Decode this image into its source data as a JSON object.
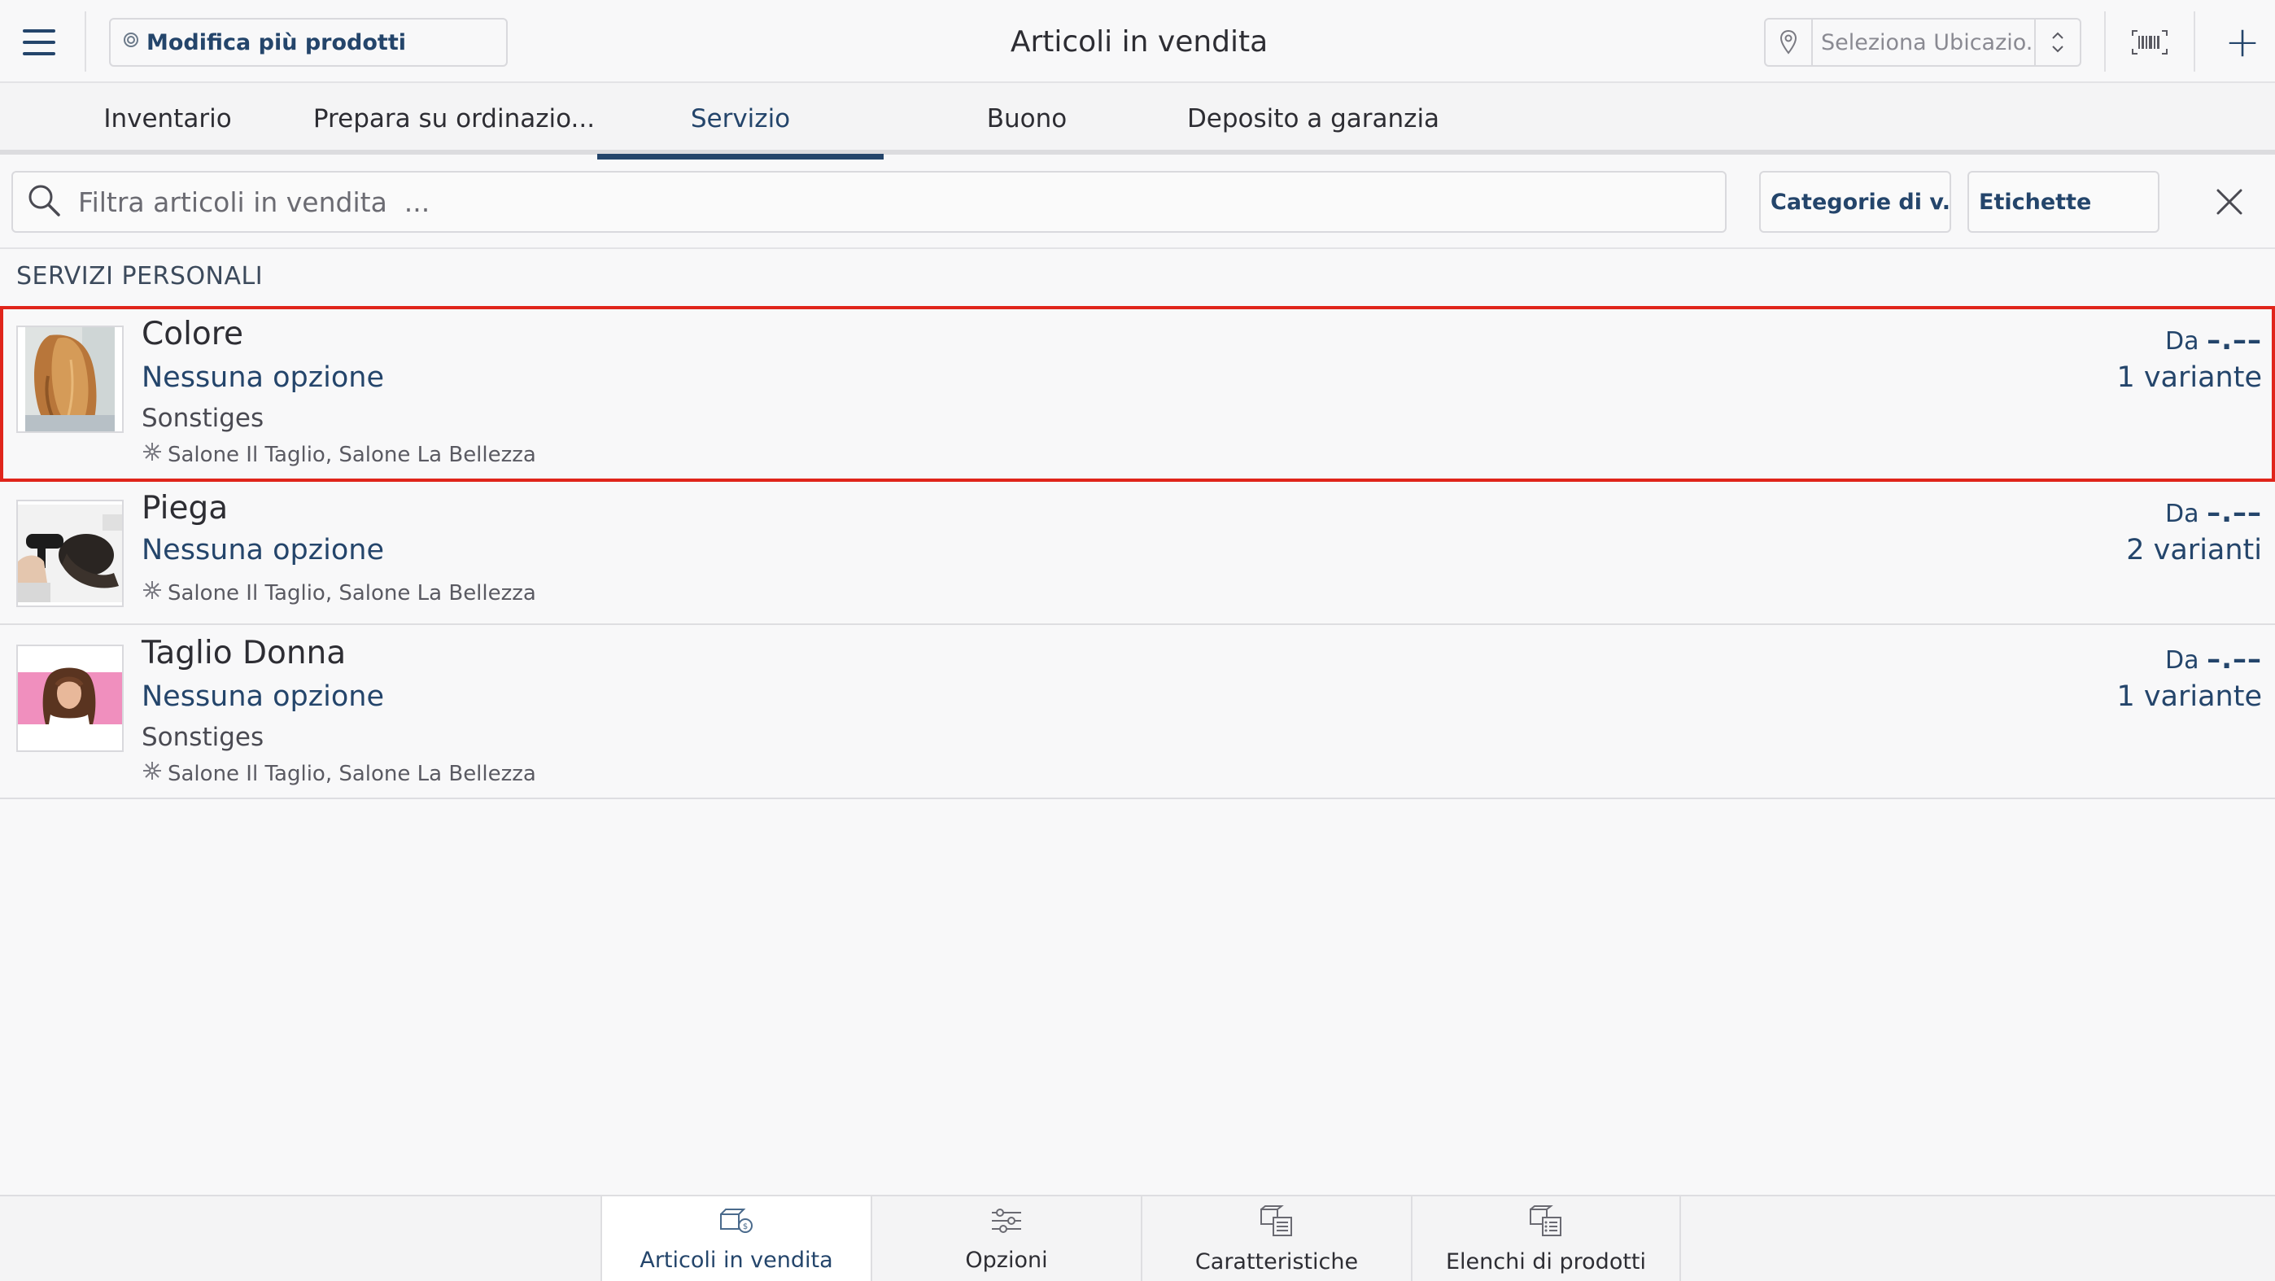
{
  "header": {
    "multi_edit_label": "Modifica più prodotti",
    "title": "Articoli in vendita",
    "location_placeholder": "Seleziona Ubicazio....",
    "add_label": "+"
  },
  "tabs": [
    {
      "label": "Inventario",
      "active": false
    },
    {
      "label": "Prepara su ordinazio...",
      "active": false
    },
    {
      "label": "Servizio",
      "active": true
    },
    {
      "label": "Buono",
      "active": false
    },
    {
      "label": "Deposito a garanzia",
      "active": false
    }
  ],
  "filter": {
    "search_placeholder": "Filtra articoli in vendita  ...",
    "category_label": "Categorie di v...",
    "tags_label": "Etichette"
  },
  "section": {
    "title": "SERVIZI PERSONALI"
  },
  "items": [
    {
      "name": "Colore",
      "option": "Nessuna opzione",
      "vendor": "Sonstiges",
      "locations": "Salone Il Taglio, Salone La Bellezza",
      "price_prefix": "Da",
      "price": "–.––",
      "variants": "1 variante",
      "selected": true
    },
    {
      "name": "Piega",
      "option": "Nessuna opzione",
      "locations": "Salone Il Taglio, Salone La Bellezza",
      "price_prefix": "Da",
      "price": "–.––",
      "variants": "2 varianti",
      "selected": false
    },
    {
      "name": "Taglio Donna",
      "option": "Nessuna opzione",
      "vendor": "Sonstiges",
      "locations": "Salone Il Taglio, Salone La Bellezza",
      "price_prefix": "Da",
      "price": "–.––",
      "variants": "1 variante",
      "selected": false
    }
  ],
  "bottom_nav": [
    {
      "label": "Articoli in vendita",
      "icon": "boxes-icon",
      "active": true
    },
    {
      "label": "Opzioni",
      "icon": "sliders-icon",
      "active": false
    },
    {
      "label": "Caratteristiche",
      "icon": "box-list-icon",
      "active": false
    },
    {
      "label": "Elenchi di prodotti",
      "icon": "box-list-icon",
      "active": false
    }
  ],
  "colors": {
    "accent": "#24456b",
    "selection": "#e0251b",
    "background": "#f8f8f9"
  }
}
